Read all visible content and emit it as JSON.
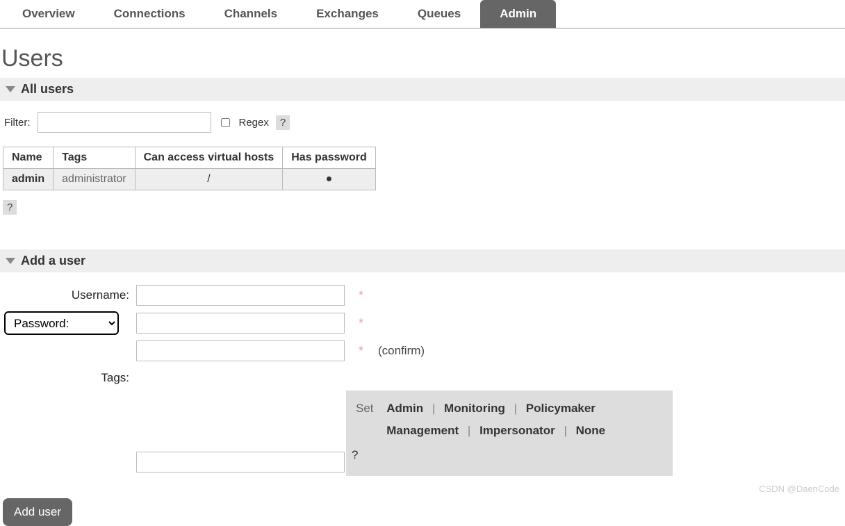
{
  "tabs": {
    "overview": "Overview",
    "connections": "Connections",
    "channels": "Channels",
    "exchanges": "Exchanges",
    "queues": "Queues",
    "admin": "Admin"
  },
  "page_title": "Users",
  "sections": {
    "all_users": "All users",
    "add_user": "Add a user"
  },
  "filter": {
    "label": "Filter:",
    "regex_label": "Regex",
    "help": "?"
  },
  "table": {
    "headers": {
      "name": "Name",
      "tags": "Tags",
      "vhosts": "Can access virtual hosts",
      "password": "Has password"
    },
    "rows": [
      {
        "name": "admin",
        "tags": "administrator",
        "vhosts": "/",
        "password": "●"
      }
    ]
  },
  "help_below": "?",
  "form": {
    "username_label": "Username:",
    "password_option": "Password:",
    "confirm_label": "(confirm)",
    "tags_label": "Tags:",
    "required": "*",
    "tag_set_label": "Set",
    "tag_options": [
      "Admin",
      "Monitoring",
      "Policymaker",
      "Management",
      "Impersonator",
      "None"
    ],
    "tag_help": "?",
    "submit": "Add user"
  },
  "watermark": "CSDN @DaenCode"
}
